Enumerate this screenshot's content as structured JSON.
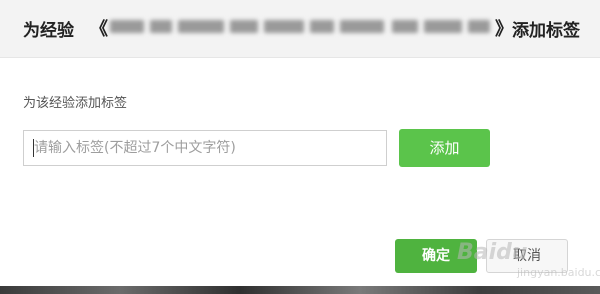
{
  "header": {
    "prefix": "为经验",
    "quote_open": "《",
    "quote_close": "》",
    "suffix": "添加标签"
  },
  "form": {
    "section_label": "为该经验添加标签",
    "tag_input_placeholder": "请输入标签(不超过7个中文字符)",
    "tag_input_value": "",
    "add_label": "添加"
  },
  "footer": {
    "confirm_label": "确定",
    "cancel_label": "取消"
  },
  "watermark": {
    "text": "Baidu",
    "subtext": "jingyan.baidu.com"
  },
  "colors": {
    "accent_green": "#5bc44b",
    "header_bg": "#f3f3f3"
  }
}
